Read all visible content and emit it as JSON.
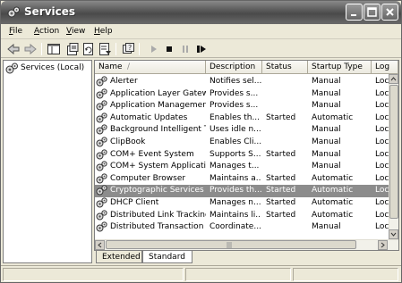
{
  "window": {
    "title": "Services"
  },
  "menu": [
    "File",
    "Action",
    "View",
    "Help"
  ],
  "menu_accel": [
    "F",
    "A",
    "V",
    "H"
  ],
  "tree": {
    "root_label": "Services (Local)"
  },
  "columns": [
    "Name",
    "Description",
    "Status",
    "Startup Type",
    "Log"
  ],
  "sort_indicator": "/",
  "services": [
    {
      "name": "Alerter",
      "description": "Notifies sel...",
      "status": "",
      "startup": "Manual",
      "log": "Loc"
    },
    {
      "name": "Application Layer Gatew...",
      "description": "Provides s...",
      "status": "",
      "startup": "Manual",
      "log": "Loc"
    },
    {
      "name": "Application Management",
      "description": "Provides s...",
      "status": "",
      "startup": "Manual",
      "log": "Loc"
    },
    {
      "name": "Automatic Updates",
      "description": "Enables th...",
      "status": "Started",
      "startup": "Automatic",
      "log": "Loc"
    },
    {
      "name": "Background Intelligent T...",
      "description": "Uses idle n...",
      "status": "",
      "startup": "Manual",
      "log": "Loc"
    },
    {
      "name": "ClipBook",
      "description": "Enables Cli...",
      "status": "",
      "startup": "Manual",
      "log": "Loc"
    },
    {
      "name": "COM+ Event System",
      "description": "Supports S...",
      "status": "Started",
      "startup": "Manual",
      "log": "Loc"
    },
    {
      "name": "COM+ System Application",
      "description": "Manages t...",
      "status": "",
      "startup": "Manual",
      "log": "Loc"
    },
    {
      "name": "Computer Browser",
      "description": "Maintains a...",
      "status": "Started",
      "startup": "Automatic",
      "log": "Loc"
    },
    {
      "name": "Cryptographic Services",
      "description": "Provides th...",
      "status": "Started",
      "startup": "Automatic",
      "log": "Loc",
      "selected": true
    },
    {
      "name": "DHCP Client",
      "description": "Manages n...",
      "status": "Started",
      "startup": "Automatic",
      "log": "Loc"
    },
    {
      "name": "Distributed Link Tracking ...",
      "description": "Maintains li...",
      "status": "Started",
      "startup": "Automatic",
      "log": "Loc"
    },
    {
      "name": "Distributed Transaction ...",
      "description": "Coordinate...",
      "status": "",
      "startup": "Manual",
      "log": "Loc"
    }
  ],
  "tabs": [
    "Extended",
    "Standard"
  ],
  "active_tab": "Standard",
  "icons": {
    "back": "back-arrow-icon",
    "forward": "forward-arrow-icon",
    "show_tree": "show-hide-tree-icon",
    "properties": "properties-icon",
    "refresh": "refresh-icon",
    "export": "export-list-icon",
    "help": "help-icon",
    "start": "start-service-icon",
    "stop": "stop-service-icon",
    "pause": "pause-service-icon",
    "restart": "restart-service-icon"
  }
}
